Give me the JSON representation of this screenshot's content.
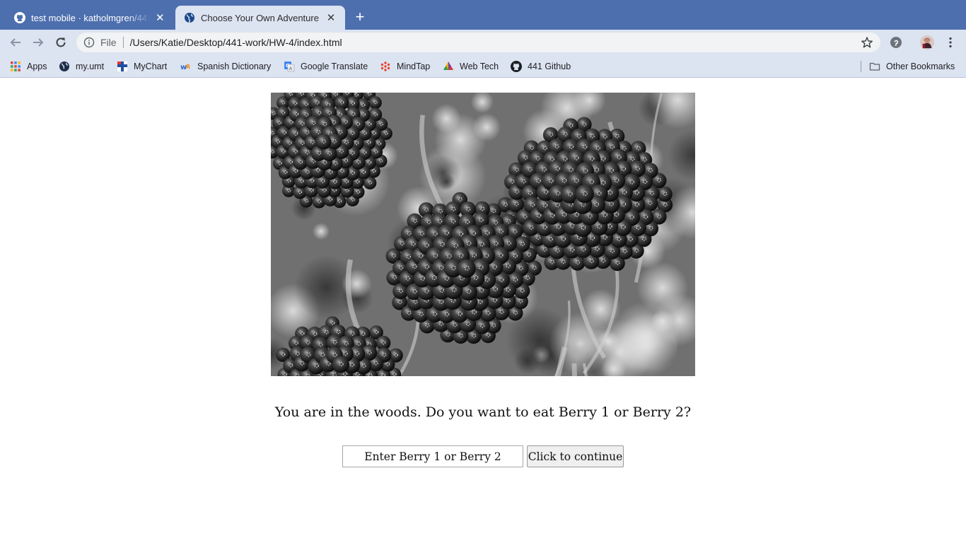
{
  "browser": {
    "tabs": [
      {
        "title": "test mobile · katholmgren/441-",
        "icon": "github-icon",
        "active": false
      },
      {
        "title": "Choose Your Own Adventure",
        "icon": "globe-icon",
        "active": true
      }
    ],
    "address": {
      "scheme_label": "File",
      "url": "/Users/Katie/Desktop/441-work/HW-4/index.html"
    },
    "bookmarks": [
      {
        "label": "Apps",
        "icon": "apps-grid-icon"
      },
      {
        "label": "my.umt",
        "icon": "globe-icon"
      },
      {
        "label": "MyChart",
        "icon": "mychart-icon"
      },
      {
        "label": "Spanish Dictionary",
        "icon": "spanishdict-icon"
      },
      {
        "label": "Google Translate",
        "icon": "google-translate-icon"
      },
      {
        "label": "MindTap",
        "icon": "mindtap-icon"
      },
      {
        "label": "Web Tech",
        "icon": "webtech-icon"
      },
      {
        "label": "441 Github",
        "icon": "github-icon"
      }
    ],
    "other_bookmarks": "Other Bookmarks",
    "colors": {
      "tabstrip": "#4d6fae",
      "toolbar": "#dce3f1"
    }
  },
  "page": {
    "image": {
      "subject": "black-and-white photo of clusters of dark berries",
      "icon": "berries-photo"
    },
    "prompt": "You are in the woods. Do you want to eat Berry 1 or Berry 2?",
    "input_placeholder": "Enter Berry 1 or Berry 2",
    "button_label": "Click to continue"
  }
}
